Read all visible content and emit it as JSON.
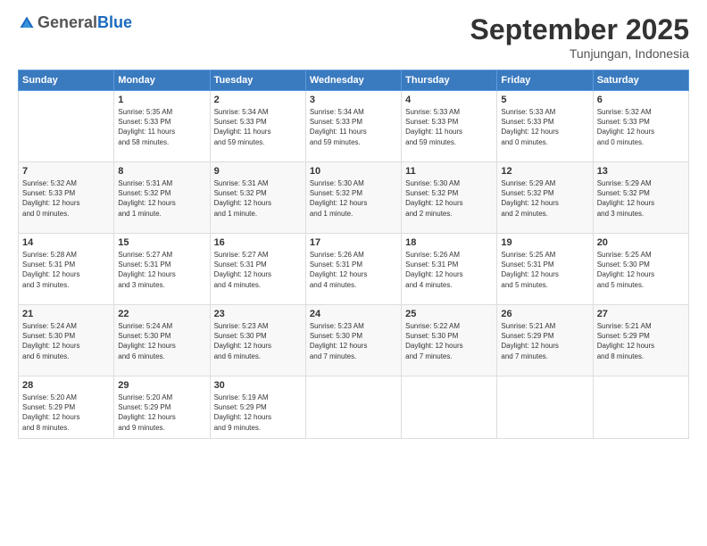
{
  "header": {
    "logo_general": "General",
    "logo_blue": "Blue",
    "month_title": "September 2025",
    "subtitle": "Tunjungan, Indonesia"
  },
  "calendar": {
    "days_of_week": [
      "Sunday",
      "Monday",
      "Tuesday",
      "Wednesday",
      "Thursday",
      "Friday",
      "Saturday"
    ],
    "weeks": [
      [
        {
          "day": "",
          "info": ""
        },
        {
          "day": "1",
          "info": "Sunrise: 5:35 AM\nSunset: 5:33 PM\nDaylight: 11 hours\nand 58 minutes."
        },
        {
          "day": "2",
          "info": "Sunrise: 5:34 AM\nSunset: 5:33 PM\nDaylight: 11 hours\nand 59 minutes."
        },
        {
          "day": "3",
          "info": "Sunrise: 5:34 AM\nSunset: 5:33 PM\nDaylight: 11 hours\nand 59 minutes."
        },
        {
          "day": "4",
          "info": "Sunrise: 5:33 AM\nSunset: 5:33 PM\nDaylight: 11 hours\nand 59 minutes."
        },
        {
          "day": "5",
          "info": "Sunrise: 5:33 AM\nSunset: 5:33 PM\nDaylight: 12 hours\nand 0 minutes."
        },
        {
          "day": "6",
          "info": "Sunrise: 5:32 AM\nSunset: 5:33 PM\nDaylight: 12 hours\nand 0 minutes."
        }
      ],
      [
        {
          "day": "7",
          "info": "Sunrise: 5:32 AM\nSunset: 5:33 PM\nDaylight: 12 hours\nand 0 minutes."
        },
        {
          "day": "8",
          "info": "Sunrise: 5:31 AM\nSunset: 5:32 PM\nDaylight: 12 hours\nand 1 minute."
        },
        {
          "day": "9",
          "info": "Sunrise: 5:31 AM\nSunset: 5:32 PM\nDaylight: 12 hours\nand 1 minute."
        },
        {
          "day": "10",
          "info": "Sunrise: 5:30 AM\nSunset: 5:32 PM\nDaylight: 12 hours\nand 1 minute."
        },
        {
          "day": "11",
          "info": "Sunrise: 5:30 AM\nSunset: 5:32 PM\nDaylight: 12 hours\nand 2 minutes."
        },
        {
          "day": "12",
          "info": "Sunrise: 5:29 AM\nSunset: 5:32 PM\nDaylight: 12 hours\nand 2 minutes."
        },
        {
          "day": "13",
          "info": "Sunrise: 5:29 AM\nSunset: 5:32 PM\nDaylight: 12 hours\nand 3 minutes."
        }
      ],
      [
        {
          "day": "14",
          "info": "Sunrise: 5:28 AM\nSunset: 5:31 PM\nDaylight: 12 hours\nand 3 minutes."
        },
        {
          "day": "15",
          "info": "Sunrise: 5:27 AM\nSunset: 5:31 PM\nDaylight: 12 hours\nand 3 minutes."
        },
        {
          "day": "16",
          "info": "Sunrise: 5:27 AM\nSunset: 5:31 PM\nDaylight: 12 hours\nand 4 minutes."
        },
        {
          "day": "17",
          "info": "Sunrise: 5:26 AM\nSunset: 5:31 PM\nDaylight: 12 hours\nand 4 minutes."
        },
        {
          "day": "18",
          "info": "Sunrise: 5:26 AM\nSunset: 5:31 PM\nDaylight: 12 hours\nand 4 minutes."
        },
        {
          "day": "19",
          "info": "Sunrise: 5:25 AM\nSunset: 5:31 PM\nDaylight: 12 hours\nand 5 minutes."
        },
        {
          "day": "20",
          "info": "Sunrise: 5:25 AM\nSunset: 5:30 PM\nDaylight: 12 hours\nand 5 minutes."
        }
      ],
      [
        {
          "day": "21",
          "info": "Sunrise: 5:24 AM\nSunset: 5:30 PM\nDaylight: 12 hours\nand 6 minutes."
        },
        {
          "day": "22",
          "info": "Sunrise: 5:24 AM\nSunset: 5:30 PM\nDaylight: 12 hours\nand 6 minutes."
        },
        {
          "day": "23",
          "info": "Sunrise: 5:23 AM\nSunset: 5:30 PM\nDaylight: 12 hours\nand 6 minutes."
        },
        {
          "day": "24",
          "info": "Sunrise: 5:23 AM\nSunset: 5:30 PM\nDaylight: 12 hours\nand 7 minutes."
        },
        {
          "day": "25",
          "info": "Sunrise: 5:22 AM\nSunset: 5:30 PM\nDaylight: 12 hours\nand 7 minutes."
        },
        {
          "day": "26",
          "info": "Sunrise: 5:21 AM\nSunset: 5:29 PM\nDaylight: 12 hours\nand 7 minutes."
        },
        {
          "day": "27",
          "info": "Sunrise: 5:21 AM\nSunset: 5:29 PM\nDaylight: 12 hours\nand 8 minutes."
        }
      ],
      [
        {
          "day": "28",
          "info": "Sunrise: 5:20 AM\nSunset: 5:29 PM\nDaylight: 12 hours\nand 8 minutes."
        },
        {
          "day": "29",
          "info": "Sunrise: 5:20 AM\nSunset: 5:29 PM\nDaylight: 12 hours\nand 9 minutes."
        },
        {
          "day": "30",
          "info": "Sunrise: 5:19 AM\nSunset: 5:29 PM\nDaylight: 12 hours\nand 9 minutes."
        },
        {
          "day": "",
          "info": ""
        },
        {
          "day": "",
          "info": ""
        },
        {
          "day": "",
          "info": ""
        },
        {
          "day": "",
          "info": ""
        }
      ]
    ]
  }
}
